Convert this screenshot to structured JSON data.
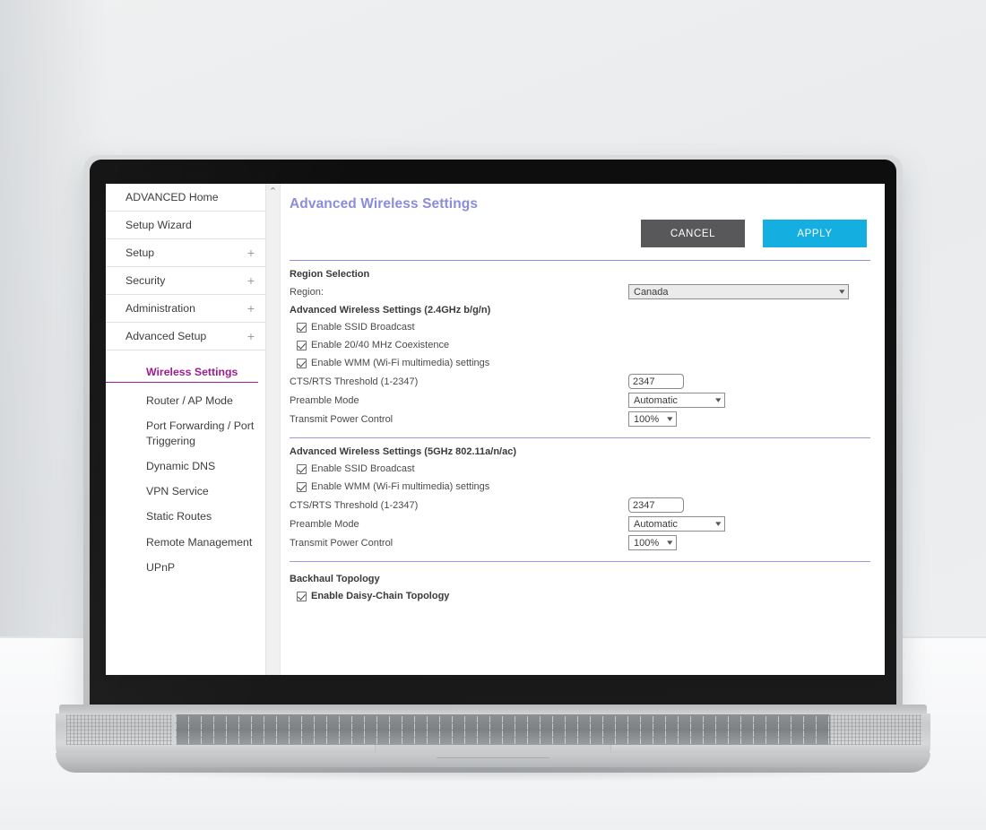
{
  "browser": {
    "page_title": "Advanced Wireless Settings"
  },
  "sidebar": {
    "top_items": [
      {
        "label": "ADVANCED Home",
        "expander": ""
      },
      {
        "label": "Setup Wizard",
        "expander": ""
      },
      {
        "label": "Setup",
        "expander": "+"
      },
      {
        "label": "Security",
        "expander": "+"
      },
      {
        "label": "Administration",
        "expander": "+"
      },
      {
        "label": "Advanced Setup",
        "expander": "+"
      }
    ],
    "sub_items": [
      {
        "label": "Wireless Settings",
        "active": true
      },
      {
        "label": "Router / AP Mode",
        "active": false
      },
      {
        "label": "Port Forwarding / Port Triggering",
        "active": false
      },
      {
        "label": "Dynamic DNS",
        "active": false
      },
      {
        "label": "VPN Service",
        "active": false
      },
      {
        "label": "Static Routes",
        "active": false
      },
      {
        "label": "Remote Management",
        "active": false
      },
      {
        "label": "UPnP",
        "active": false
      }
    ]
  },
  "scrollbar": {
    "up_arrow": "⌃"
  },
  "main": {
    "title": "Advanced Wireless Settings",
    "cancel_label": "CANCEL",
    "apply_label": "APPLY",
    "region_section": {
      "heading": "Region Selection",
      "region_label": "Region:",
      "region_value": "Canada"
    },
    "band_24": {
      "heading": "Advanced Wireless Settings (2.4GHz b/g/n)",
      "checkboxes": [
        {
          "label": "Enable SSID Broadcast",
          "checked": true
        },
        {
          "label": "Enable 20/40 MHz Coexistence",
          "checked": true
        },
        {
          "label": "Enable WMM (Wi-Fi multimedia) settings",
          "checked": true
        }
      ],
      "cts_rts_label": "CTS/RTS Threshold (1-2347)",
      "cts_rts_value": "2347",
      "preamble_label": "Preamble Mode",
      "preamble_value": "Automatic",
      "power_label": "Transmit Power Control",
      "power_value": "100%"
    },
    "band_5": {
      "heading": "Advanced Wireless Settings (5GHz 802.11a/n/ac)",
      "checkboxes": [
        {
          "label": "Enable SSID Broadcast",
          "checked": true
        },
        {
          "label": "Enable WMM (Wi-Fi multimedia) settings",
          "checked": true
        }
      ],
      "cts_rts_label": "CTS/RTS Threshold (1-2347)",
      "cts_rts_value": "2347",
      "preamble_label": "Preamble Mode",
      "preamble_value": "Automatic",
      "power_label": "Transmit Power Control",
      "power_value": "100%"
    },
    "backhaul": {
      "heading": "Backhaul Topology",
      "checkbox_label": "Enable Daisy-Chain Topology",
      "checked": true
    }
  },
  "colors": {
    "title_purple": "#8b8cdc",
    "active_nav_magenta": "#9c1d8f",
    "apply_blue": "#14aee0",
    "cancel_gray": "#58585a",
    "divider_purple": "#8b8cdc"
  }
}
